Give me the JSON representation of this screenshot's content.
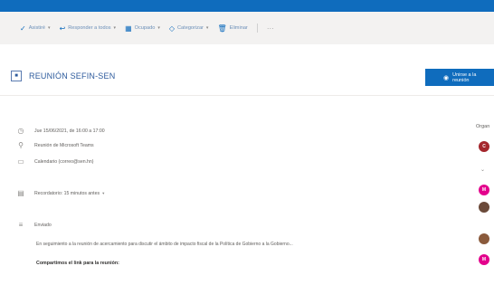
{
  "toolbar": {
    "items": [
      {
        "icon": "check-icon",
        "label": "Asistiré"
      },
      {
        "icon": "reply-all-icon",
        "label": "Responder a todos"
      },
      {
        "icon": "calendar-icon",
        "label": "Ocupado"
      },
      {
        "icon": "tag-icon",
        "label": "Categorizar"
      },
      {
        "icon": "trash-icon",
        "label": "Eliminar"
      }
    ],
    "more": "···"
  },
  "event": {
    "title": "REUNIÓN SEFIN-SEN",
    "join_button": "Unirse a la reunión"
  },
  "details": {
    "date_time": "Jue 15/06/2021, de 16:00 a 17:00",
    "location": "Reunión de Microsoft Teams",
    "calendar": "Calendario (correo@sen.hn)",
    "reminder": "Recordatorio: 15 minutos antes",
    "organizer": "Enviado",
    "message": "En seguimiento a la reunión de acercamiento para discutir el ámbito de impacto fiscal de la Política de Gobierno a la Gobierno...",
    "link_text": "Compartimos el link para la reunión:"
  },
  "attendees": {
    "label": "Organ",
    "avatars": [
      {
        "initials": "C",
        "color": "#a4262c"
      },
      {
        "initials": "M",
        "color": "#e3008c"
      },
      {
        "initials": "",
        "color": "#6b4a3a"
      },
      {
        "initials": "",
        "color": "#8a5a3c"
      },
      {
        "initials": "M",
        "color": "#e3008c"
      }
    ],
    "expand_icon": "chevron-down-icon"
  }
}
